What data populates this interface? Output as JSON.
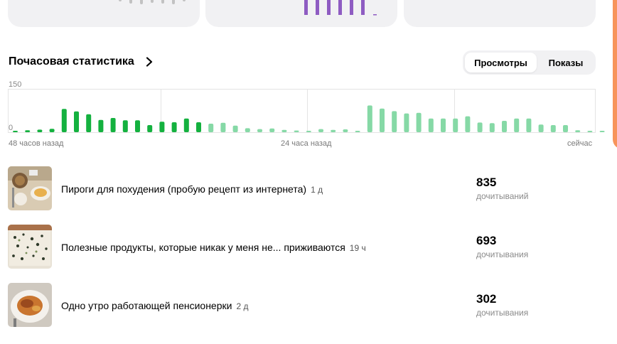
{
  "colors": {
    "dark_green": "#14b13f",
    "light_green": "#86d9a6",
    "purple": "#8e5cc2",
    "gray_bar": "#c2c2c2",
    "accent_orange": "#f7945b"
  },
  "header": {
    "title": "Почасовая статистика",
    "toggle": {
      "active": "Просмотры",
      "inactive": "Показы"
    }
  },
  "chart_data": {
    "type": "bar",
    "ylim": [
      0,
      150
    ],
    "y_ticks": [
      "150",
      "0"
    ],
    "x_labels": [
      "48 часов назад",
      "24 часа назад",
      "сейчас"
    ],
    "series": [
      {
        "values": [
          4,
          7,
          9,
          12,
          82,
          73,
          63,
          43,
          50,
          42,
          42,
          25,
          37,
          35,
          48,
          35
        ]
      },
      {
        "values": [
          30,
          33,
          23,
          14,
          11,
          13,
          8,
          6,
          5,
          11,
          8,
          10,
          5,
          94,
          83,
          74,
          66,
          68,
          48,
          48,
          48,
          56,
          34,
          32,
          40,
          48,
          48,
          27,
          25,
          25,
          7,
          5,
          5
        ]
      }
    ]
  },
  "articles": [
    {
      "title": "Пироги для похудения (пробую рецепт из интернета)",
      "age": "1 д",
      "count": "835",
      "count_label": "дочитываний"
    },
    {
      "title": "Полезные продукты, которые никак у меня не... приживаются",
      "age": "19 ч",
      "count": "693",
      "count_label": "дочитывания"
    },
    {
      "title": "Одно утро работающей пенсионерки",
      "age": "2 д",
      "count": "302",
      "count_label": "дочитывания"
    }
  ]
}
